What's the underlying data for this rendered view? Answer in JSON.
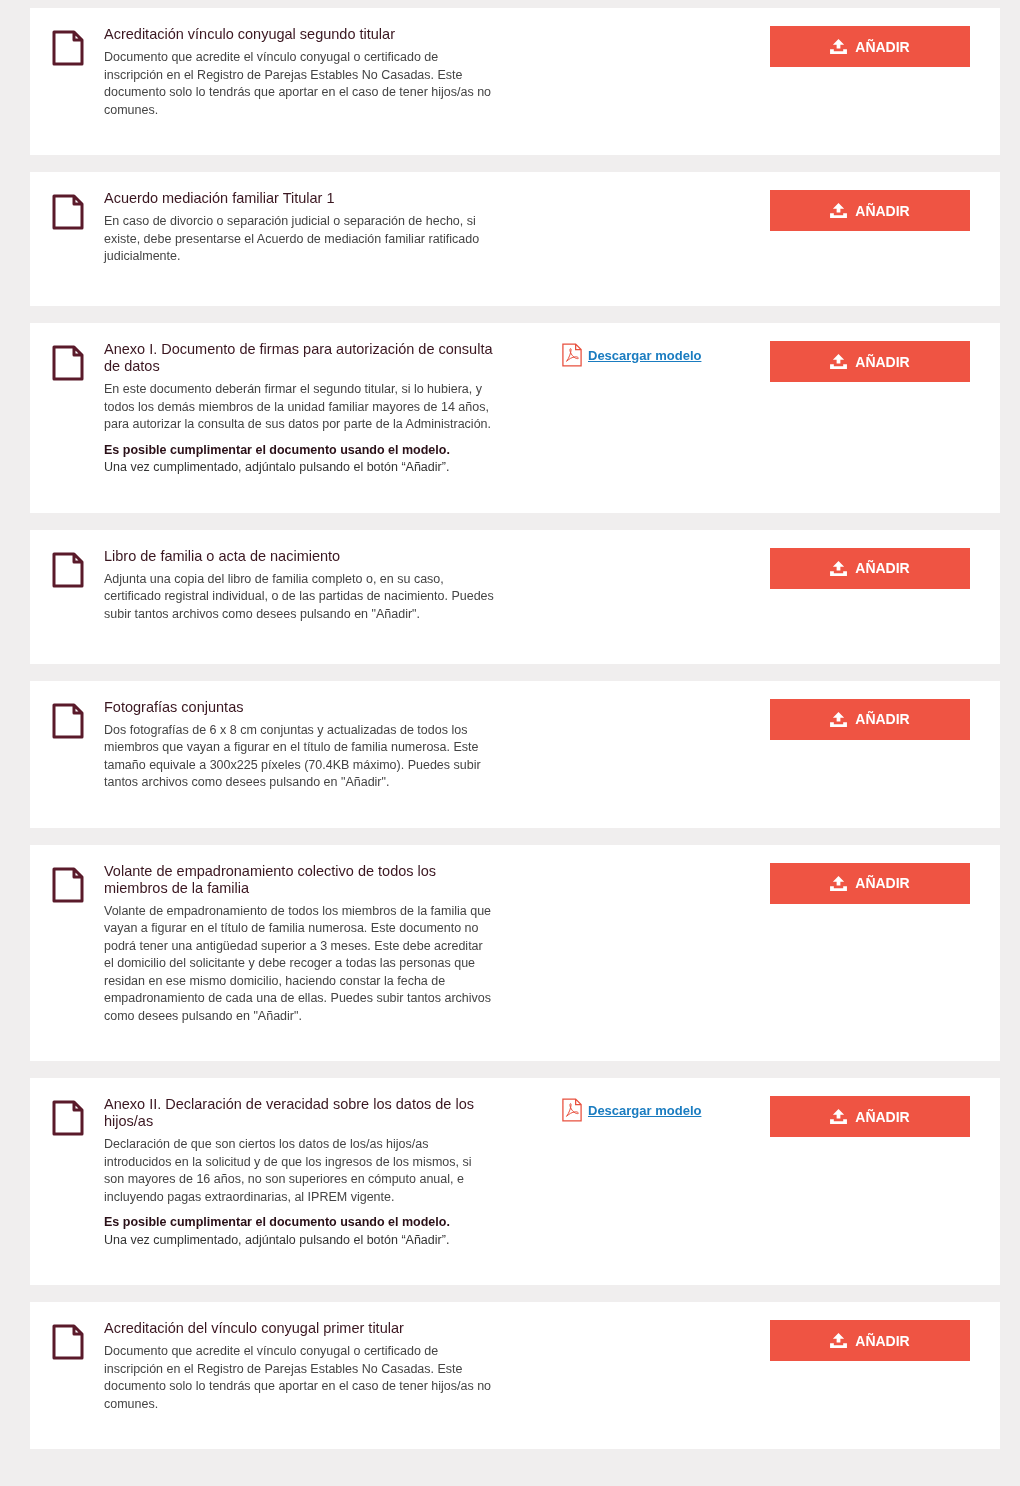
{
  "documents": [
    {
      "title": "Acreditación vínculo conyugal segundo titular",
      "description": "Documento que acredite el vínculo conyugal o certificado de inscripción en el Registro de Parejas Estables No Casadas. Este documento solo lo tendrás que aportar en el caso de tener hijos/as no comunes.",
      "button": "AÑADIR"
    },
    {
      "title": "Acuerdo mediación familiar Titular 1",
      "description": "En caso de divorcio o separación judicial o separación de hecho, si existe, debe presentarse el Acuerdo de mediación familiar ratificado judicialmente.",
      "button": "AÑADIR"
    },
    {
      "title": "Anexo I. Documento de firmas para autorización de consulta de datos",
      "description": "En este documento deberán firmar el segundo titular, si lo hubiera, y todos los demás miembros de la unidad familiar mayores de 14 años, para autorizar la consulta de sus datos por parte de la Administración.",
      "note": "**Es posible cumplimentar el documento usando el modelo.**\nUna vez cumplimentado, adjúntalo pulsando el botón “Añadir”.",
      "download_link": "Descargar modelo",
      "button": "AÑADIR"
    },
    {
      "title": "Libro de familia o acta de nacimiento",
      "description": "Adjunta una copia del libro de familia completo o, en su caso, certificado registral individual, o de las partidas de nacimiento. Puedes subir tantos archivos como desees pulsando en \"Añadir\".",
      "button": "AÑADIR"
    },
    {
      "title": "Fotografías conjuntas",
      "description": "Dos fotografías de 6 x 8 cm conjuntas y actualizadas de todos los miembros que vayan a figurar en el título de familia numerosa. Este tamaño equivale a 300x225 píxeles (70.4KB máximo). Puedes subir tantos archivos como desees pulsando en \"Añadir\".",
      "button": "AÑADIR"
    },
    {
      "title": "Volante de empadronamiento colectivo de todos los miembros de la familia",
      "description": "Volante de empadronamiento de todos los miembros de la familia que vayan a figurar en el título de familia numerosa. Este documento no podrá tener una antigüedad superior a 3 meses. Este debe acreditar el domicilio del solicitante y debe recoger a todas las personas que residan en ese mismo domicilio, haciendo constar la fecha de empadronamiento de cada una de ellas. Puedes subir tantos archivos como desees pulsando en \"Añadir\".",
      "button": "AÑADIR"
    },
    {
      "title": "Anexo II. Declaración de veracidad sobre los datos de los hijos/as",
      "description": "Declaración de que son ciertos los datos de los/as hijos/as introducidos en la solicitud y de que los ingresos de los mismos, si son mayores de 16 años, no son superiores en cómputo anual, e incluyendo pagas extraordinarias, al IPREM vigente.",
      "note": "**Es posible cumplimentar el documento usando el modelo.**\nUna vez cumplimentado, adjúntalo pulsando el botón “Añadir”.",
      "download_link": "Descargar modelo",
      "button": "AÑADIR"
    },
    {
      "title": "Acreditación del vínculo conyugal primer titular",
      "description": "Documento que acredite el vínculo conyugal o certificado de inscripción en el Registro de Parejas Estables No Casadas. Este documento solo lo tendrás que aportar en el caso de tener hijos/as no comunes.",
      "button": "AÑADIR"
    }
  ]
}
